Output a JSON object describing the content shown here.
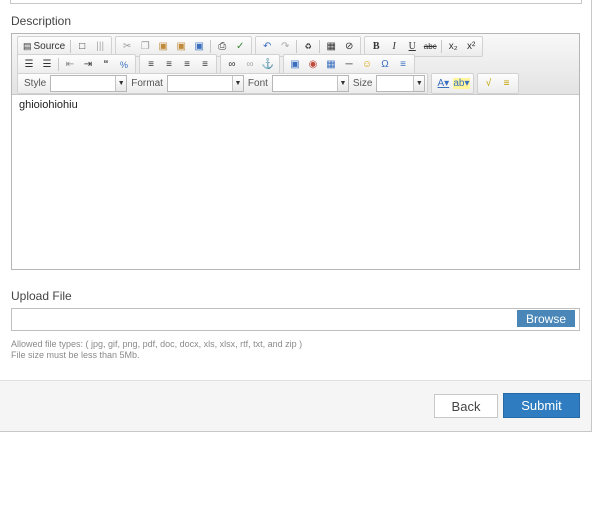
{
  "form": {
    "description_label": "Description",
    "upload_label": "Upload File",
    "browse_label": "Browse",
    "hint_types": "Allowed file types: ( jpg, gif, png, pdf, doc, docx, xls, xlsx, rtf, txt, and zip )",
    "hint_size": "File size must be less than 5Mb.",
    "back_label": "Back",
    "submit_label": "Submit"
  },
  "editor": {
    "content": "ghioiohiohiu",
    "source_label": "Source",
    "style_label": "Style",
    "format_label": "Format",
    "font_label": "Font",
    "size_label": "Size"
  },
  "colors": {
    "primary_button": "#2f7dc0",
    "browse_button": "#4a87b8"
  }
}
